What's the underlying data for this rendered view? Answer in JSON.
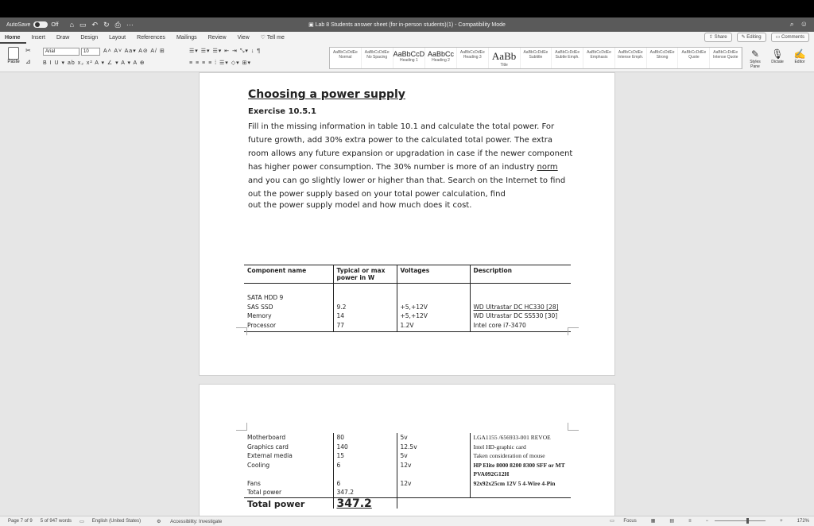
{
  "titlebar": {
    "autosave_label": "AutoSave",
    "autosave_state": "Off",
    "doc_title": "Lab 8 Students answer sheet (for in-person students)(1) - Compatibility Mode"
  },
  "tabs": [
    "Home",
    "Insert",
    "Draw",
    "Design",
    "Layout",
    "References",
    "Mailings",
    "Review",
    "View"
  ],
  "tell_me": "Tell me",
  "share_label": "Share",
  "editing_label": "Editing",
  "comments_label": "Comments",
  "ribbon": {
    "paste_label": "Paste",
    "font_name": "Arial",
    "font_size": "10",
    "styles": [
      {
        "preview": "AaBbCcDdEe",
        "name": "Normal"
      },
      {
        "preview": "AaBbCcDdEe",
        "name": "No Spacing"
      },
      {
        "preview": "AaBbCcD",
        "name": "Heading 1"
      },
      {
        "preview": "AaBbCc",
        "name": "Heading 2"
      },
      {
        "preview": "AaBbCcDdEe",
        "name": "Heading 3"
      },
      {
        "preview": "AaBb",
        "name": "Title"
      },
      {
        "preview": "AaBbCcDdEe",
        "name": "Subtitle"
      },
      {
        "preview": "AaBbCcDdEe",
        "name": "Subtle Emph."
      },
      {
        "preview": "AaBbCcDdEe",
        "name": "Emphasis"
      },
      {
        "preview": "AaBbCcDdEe",
        "name": "Intense Emph."
      },
      {
        "preview": "AaBbCcDdEe",
        "name": "Strong"
      },
      {
        "preview": "AaBbCcDdEe",
        "name": "Quote"
      },
      {
        "preview": "AaBbCcDdEe",
        "name": "Intense Quote"
      }
    ],
    "styles_pane": "Styles Pane",
    "dictate": "Dictate",
    "editor": "Editor"
  },
  "doc": {
    "heading": "Choosing a power supply",
    "exercise": "Exercise 10.5.1",
    "para_before_norm": "Fill in the missing information in table 10.1 and calculate the total power. For future growth, add 30% extra power to the calculated total power. The extra room allows any future expansion or upgradation in case if the newer component has higher power consumption. The 30% number is more of an industry ",
    "para_norm": "norm",
    "para_after_norm": " and you can go slightly lower or higher than that. Search on the Internet to find out the power supply based on your total power calculation, find",
    "last_line": "out the power supply model and how much does it cost."
  },
  "table": {
    "headers": [
      "Component name",
      "Typical or max power in W",
      "Voltages",
      "Description"
    ],
    "rows_page1": [
      [
        "SATA HDD 9",
        "",
        "",
        ""
      ],
      [
        "SAS SSD",
        "9.2",
        "+5,+12V",
        "WD Ultrastar DC HC330 [28]"
      ],
      [
        "Memory",
        "14",
        "+5,+12V",
        "WD Ultrastar DC SS530 [30]"
      ],
      [
        "Processor",
        "77",
        "1.2V",
        "Intel core i7-3470"
      ]
    ],
    "rows_page2": [
      [
        "Motherboard",
        "80",
        "5v",
        "LGA1155 /656933-001 REVOE"
      ],
      [
        "Graphics card",
        "140",
        "12.5v",
        "Intel HD-graphic card"
      ],
      [
        "External media",
        "15",
        "5v",
        "Taken consideration of mouse"
      ],
      [
        "Cooling",
        "6",
        "12v",
        "HP Elite 8000 8200 8300 SFF or MT PVA092G12H"
      ],
      [
        "Fans",
        "6",
        "12v",
        "92x92x25cm 12V 5 4-Wire 4-Pin"
      ],
      [
        "Total power",
        "347.2",
        "",
        ""
      ]
    ],
    "total_label": "Total power",
    "total_value": "347.2"
  },
  "status": {
    "page": "Page 7 of 9",
    "words": "5 of 947 words",
    "language": "English (United States)",
    "accessibility": "Accessibility: Investigate",
    "focus": "Focus",
    "zoom": "172%"
  }
}
